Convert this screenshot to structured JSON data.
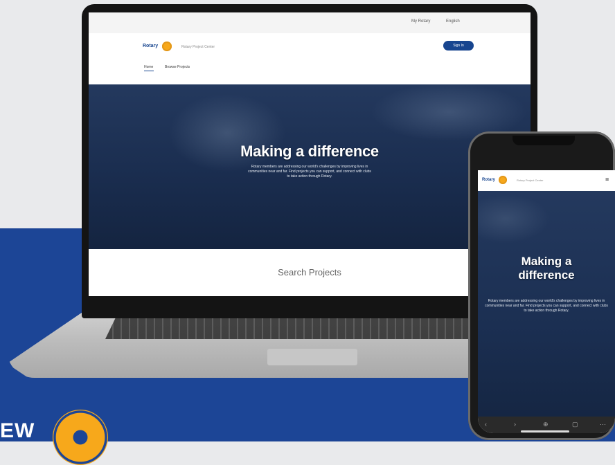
{
  "laptop": {
    "utility": {
      "item1": "My Rotary",
      "item2": "English"
    },
    "header": {
      "logo": "Rotary",
      "subtitle": "Rotary Project Center",
      "signin": "Sign In",
      "nav": [
        "Home",
        "Browse Projects"
      ]
    },
    "hero": {
      "title": "Making a difference",
      "body": "Rotary members are addressing our world's challenges by improving lives in communities near and far. Find projects you can support, and connect with clubs to take action through Rotary."
    },
    "search": {
      "title": "Search Projects"
    }
  },
  "phone": {
    "header": {
      "logo": "Rotary",
      "subtitle": "Rotary Project Center",
      "menu": "≡"
    },
    "hero": {
      "title_line1": "Making a",
      "title_line2": "difference",
      "body": "Rotary members are addressing our world's challenges by improving lives in communities near and far. Find projects you can support, and connect with clubs to take action through Rotary."
    },
    "toolbar": [
      "‹",
      "›",
      "⊕",
      "▢",
      "⋯"
    ]
  },
  "brand": {
    "text": "EW"
  },
  "colors": {
    "rotary_blue": "#17458f",
    "rotary_gold": "#f7a81b",
    "background_blue": "#1c4596"
  }
}
